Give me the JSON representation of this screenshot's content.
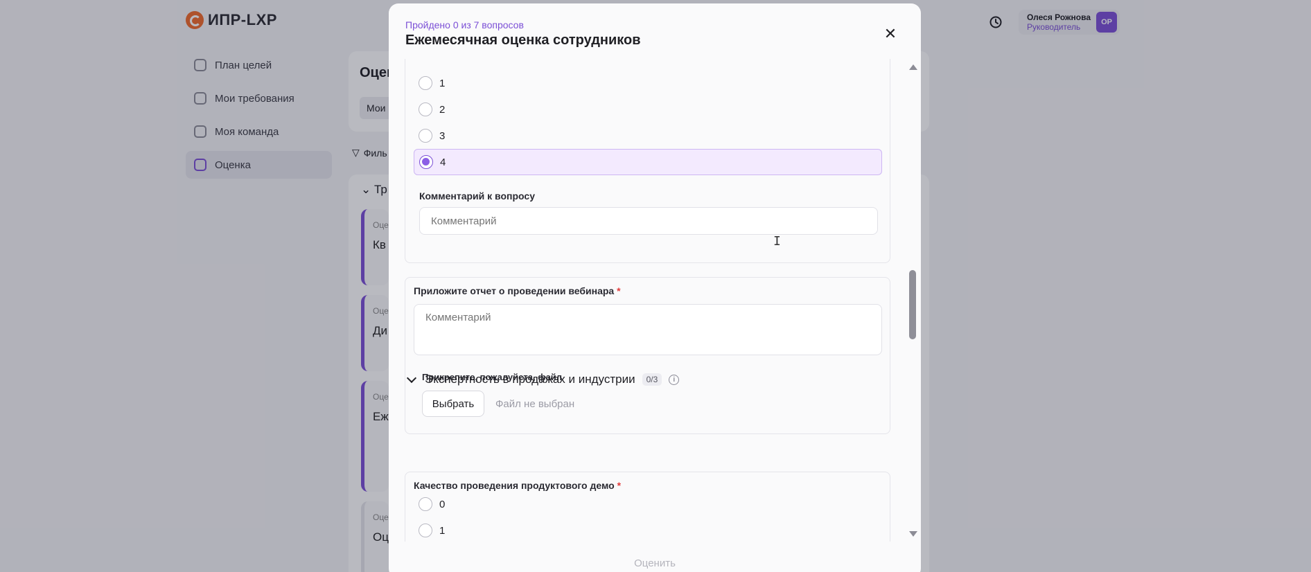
{
  "app": {
    "logo_text": "ИПР-LXP"
  },
  "nav": {
    "items": [
      {
        "label": "План целей",
        "icon": "target-icon"
      },
      {
        "label": "Мои требования",
        "icon": "requirements-icon"
      },
      {
        "label": "Моя команда",
        "icon": "team-icon"
      },
      {
        "label": "Оценка",
        "icon": "evaluation-icon",
        "active": true
      }
    ]
  },
  "background": {
    "title_fragment": "Оцен",
    "tab_fragment": "Мои",
    "filter_fragment": "Филь",
    "list_head_fragment": "Тр",
    "card_fragments": [
      "Кв",
      "Ди",
      "Еж",
      "Оц"
    ],
    "card_label_fragment": "Оце"
  },
  "user": {
    "name": "Олеся Рожнова",
    "role": "Руководитель",
    "initials": "ОР"
  },
  "modal": {
    "progress": "Пройдено 0 из 7 вопросов",
    "title": "Ежемесячная оценка сотрудников",
    "q1": {
      "options": [
        "1",
        "2",
        "3",
        "4"
      ],
      "selected": "4",
      "comment_label": "Комментарий к вопросу",
      "comment_placeholder": "Комментарий"
    },
    "q2": {
      "label": "Приложите отчет о проведении вебинара",
      "required_mark": "*",
      "comment_placeholder": "Комментарий",
      "attach_label": "Прикрепите, пожалуйста, файл",
      "choose_button": "Выбрать",
      "file_status": "Файл не выбран"
    },
    "section": {
      "title": "Экспертность в продажах и индустрии",
      "count": "0/3",
      "info": "i"
    },
    "q3": {
      "label": "Качество проведения продуктового демо",
      "required_mark": "*",
      "options": [
        "0",
        "1"
      ]
    },
    "submit_button": "Оценить"
  },
  "colors": {
    "accent": "#7b4fd6",
    "required": "#e23b3b",
    "selected_bg": "#f3eafe"
  }
}
